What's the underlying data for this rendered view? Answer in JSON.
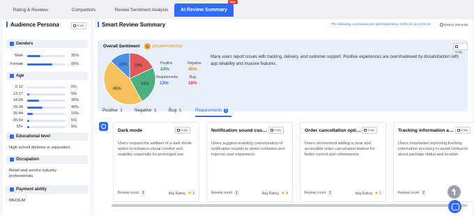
{
  "tabs": [
    {
      "label": "Rating & Reviews"
    },
    {
      "label": "Competitors"
    },
    {
      "label": "Review Sentiment Analysis"
    },
    {
      "label": "AI Review Summary",
      "badge": "New"
    }
  ],
  "persona": {
    "title": "Audience Persona",
    "copy_label": "Copy",
    "genders": {
      "title": "Genders",
      "items": [
        {
          "label": "Male",
          "pct": "35%",
          "value": 0.35
        },
        {
          "label": "Female",
          "pct": "65%",
          "value": 0.65
        }
      ]
    },
    "age": {
      "title": "Age",
      "items": [
        {
          "label": "0-12",
          "pct": "0%",
          "value": 0.0
        },
        {
          "label": "13-17",
          "pct": "5%",
          "value": 0.05
        },
        {
          "label": "18-24",
          "pct": "30%",
          "value": 0.3
        },
        {
          "label": "25-34",
          "pct": "40%",
          "value": 0.4
        },
        {
          "label": "35-44",
          "pct": "15%",
          "value": 0.15
        },
        {
          "label": "45-54",
          "pct": "5%",
          "value": 0.05
        },
        {
          "label": "55+",
          "pct": "5%",
          "value": 0.05
        }
      ]
    },
    "education": {
      "title": "Educational level",
      "value": "High school diploma or equivalent."
    },
    "occupation": {
      "title": "Occupation",
      "value": "Retail and service industry professionals."
    },
    "payment": {
      "title": "Payment ability",
      "value": "MEDIUM"
    }
  },
  "summary": {
    "title": "Smart Review Summary",
    "generated": "The following conclusions are generated time: 2025-12-11 10:21:42",
    "history": "History Records",
    "copy_label": "Copy",
    "overall_label": "Overall Sentiment",
    "overall_value": "DISAPPOINTED",
    "pie": [
      {
        "name": "Positive",
        "value": 24,
        "color": "#4caf82"
      },
      {
        "name": "Negative",
        "value": 45,
        "color": "#f6c05a"
      },
      {
        "name": "Requirements",
        "value": 13,
        "color": "#4a90e2"
      },
      {
        "name": "Bug",
        "value": 18,
        "color": "#e05a5a"
      }
    ],
    "metrics": [
      {
        "label": "Positive",
        "value": "24%",
        "color": "#2e9b5f"
      },
      {
        "label": "Negative",
        "value": "45%",
        "color": "#e8890c"
      },
      {
        "label": "Requirements",
        "value": "13%",
        "color": "#2f6bff"
      },
      {
        "label": "Bug",
        "value": "18%",
        "color": "#e53935"
      }
    ],
    "text": "Many users report issues with tracking, delivery, and customer support. Positive experiences are overshadowed by dissatisfaction with app reliability and invasive features."
  },
  "review_tabs": [
    {
      "label": "Positive",
      "count": "3"
    },
    {
      "label": "Negative",
      "count": "5"
    },
    {
      "label": "Bug",
      "count": "5"
    },
    {
      "label": "Requirements",
      "count": "5"
    }
  ],
  "cards": [
    {
      "title": "Dark mode",
      "desc": "Users request the addition of a dark mode option to enhance visual comfort and usability, especially for prolonged use.",
      "review_count": "1",
      "avg_rating": "3"
    },
    {
      "title": "Notification sound customization",
      "desc": "Users suggest enabling customization of notification sounds to avoid confusion and improve user experience.",
      "review_count": "1",
      "avg_rating": "4"
    },
    {
      "title": "Order cancellation option",
      "desc": "Users recommend adding a clear and accessible order cancellation feature for better control and convenience.",
      "review_count": "1",
      "avg_rating": "1"
    },
    {
      "title": "Tracking information accuracy",
      "desc": "Users emphasize improving tracking information accuracy to avoid confusion about package status and location.",
      "review_count": "2",
      "avg_rating": ""
    }
  ],
  "labels": {
    "review_count": "Review count",
    "avg_rating": "Avg Rating"
  }
}
